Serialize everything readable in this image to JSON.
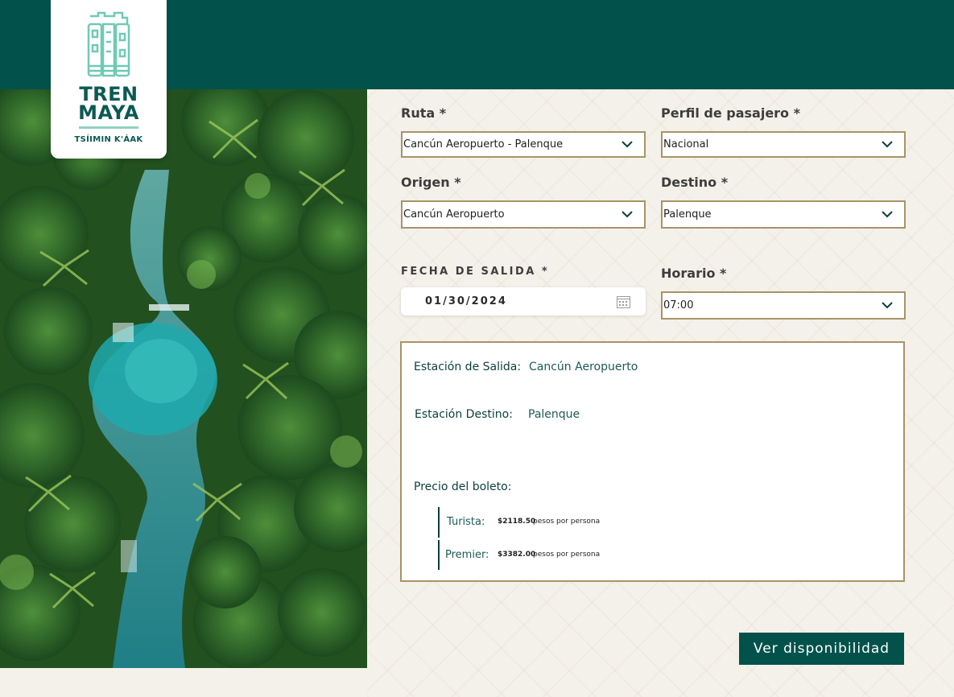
{
  "brand": {
    "title_line1": "TREN",
    "title_line2": "MAYA",
    "subtitle": "TSÍIMIN K'ÁAK",
    "primary_color": "#02524b",
    "accent_color": "#8fd3c2",
    "border_color": "#a89466"
  },
  "form": {
    "ruta": {
      "label": "Ruta *",
      "value": "Cancún Aeropuerto - Palenque"
    },
    "perfil": {
      "label": "Perfil de pasajero *",
      "value": "Nacional"
    },
    "origen": {
      "label": "Origen *",
      "value": "Cancún Aeropuerto"
    },
    "destino": {
      "label": "Destino *",
      "value": "Palenque"
    },
    "fecha": {
      "label": "FECHA DE SALIDA *",
      "value": "01/30/2024",
      "icon": "calendar-icon"
    },
    "horario": {
      "label": "Horario *",
      "value": "07:00"
    },
    "dropdown_icon": "chevron-down-icon"
  },
  "summary": {
    "salida_label": "Estación de Salida:",
    "salida_value": "Cancún Aeropuerto",
    "destino_label": "Estación Destino:",
    "destino_value": "Palenque",
    "price_title": "Precio del boleto:",
    "fares": [
      {
        "name": "Turista:",
        "amount": "$2118.50",
        "unit": "pesos por persona"
      },
      {
        "name": "Premier:",
        "amount": "$3382.00",
        "unit": "pesos por persona"
      }
    ]
  },
  "cta": {
    "label": "Ver disponibilidad"
  }
}
